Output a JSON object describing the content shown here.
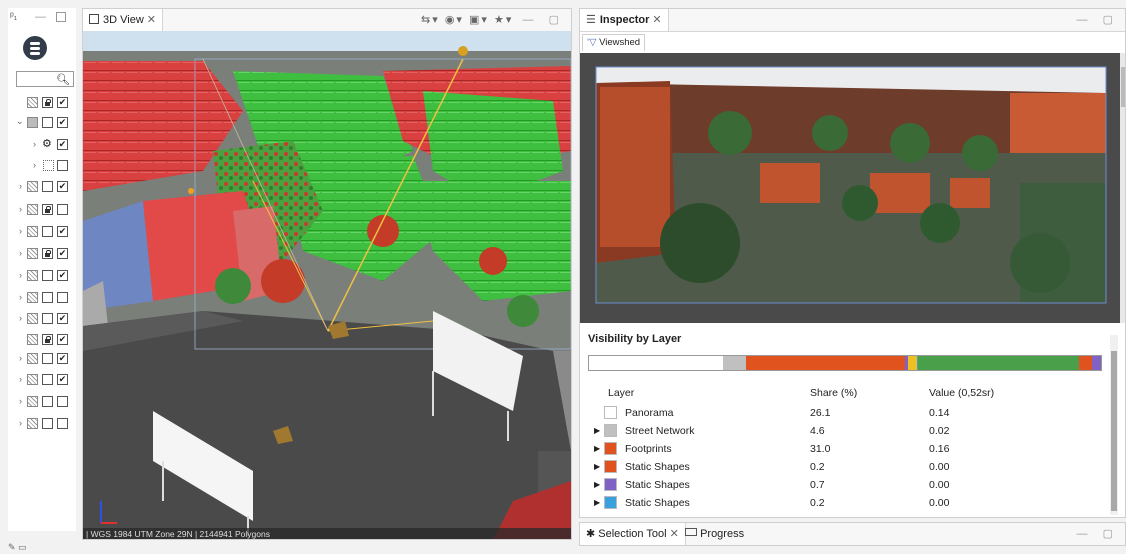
{
  "left_panel": {
    "title_glyph": "ᵖ₁"
  },
  "view3d": {
    "tab_label": "3D View",
    "status_text": "| WGS 1984 UTM Zone 29N | 2144941 Polygons"
  },
  "inspector": {
    "tab_label": "Inspector",
    "subtab_label": "Viewshed",
    "section_title": "Visibility by Layer",
    "columns": [
      "Layer",
      "Share (%)",
      "Value (0,52sr)"
    ],
    "rows": [
      {
        "name": "Panorama",
        "share": "26.1",
        "value": "0.14",
        "color": "#ffffff",
        "expandable": false
      },
      {
        "name": "Street Network",
        "share": "4.6",
        "value": "0.02",
        "color": "#c0c0c0",
        "expandable": true
      },
      {
        "name": "Footprints",
        "share": "31.0",
        "value": "0.16",
        "color": "#e0531f",
        "expandable": true
      },
      {
        "name": "Static Shapes",
        "share": "0.2",
        "value": "0.00",
        "color": "#e0531f",
        "expandable": true
      },
      {
        "name": "Static Shapes",
        "share": "0.7",
        "value": "0.00",
        "color": "#8061c4",
        "expandable": true
      },
      {
        "name": "Static Shapes",
        "share": "0.2",
        "value": "0.00",
        "color": "#3aa0e0",
        "expandable": true
      }
    ],
    "bar_segments": [
      {
        "color": "#ffffff",
        "share": 26.1
      },
      {
        "color": "#c0c0c0",
        "share": 4.6
      },
      {
        "color": "#e0531f",
        "share": 31.0
      },
      {
        "color": "#8061c4",
        "share": 0.7
      },
      {
        "color": "#f0c020",
        "share": 1.6
      },
      {
        "color": "#3aa0e0",
        "share": 0.2
      },
      {
        "color": "#4aa04a",
        "share": 31.5
      },
      {
        "color": "#e0531f",
        "share": 2.5
      },
      {
        "color": "#8061c4",
        "share": 1.8
      }
    ]
  },
  "bottom": {
    "selection_tool_label": "Selection Tool",
    "progress_label": "Progress"
  }
}
